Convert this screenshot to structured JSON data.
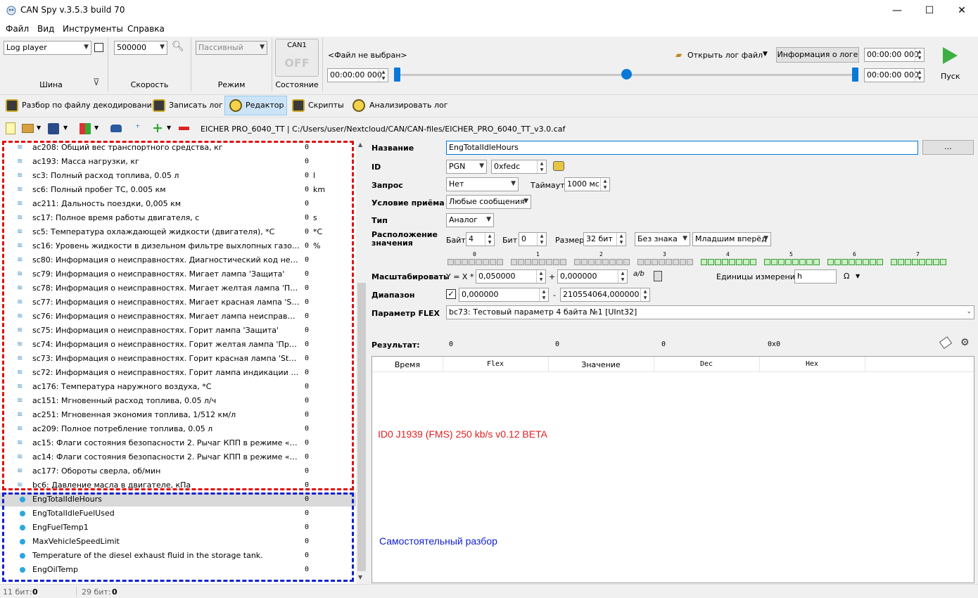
{
  "window": {
    "title": "CAN Spy v.3.5.3 build 70",
    "minimize": "—",
    "maximize": "☐",
    "close": "✕"
  },
  "menu": [
    "Файл",
    "Вид",
    "Инструменты",
    "Справка"
  ],
  "toolbar": {
    "bus": {
      "value": "Log player",
      "label": "Шина"
    },
    "speed": {
      "value": "500000",
      "label": "Скорость"
    },
    "mode": {
      "value": "Пассивный",
      "label": "Режим"
    },
    "state": {
      "channel": "CAN1",
      "value": "OFF",
      "label": "Состояние"
    },
    "file_status": "<Файл не выбран>",
    "open_log": "Открыть лог файл",
    "log_info": "Информация о логе",
    "time_start": "00:00:00 000",
    "time_left": "00:00:00  000",
    "time_end": "00:00:00 000",
    "play": "Пуск"
  },
  "tabs": [
    "Разбор по файлу декодирования",
    "Записать лог",
    "Редактор",
    "Скрипты",
    "Анализировать лог"
  ],
  "active_tab": "Редактор",
  "filepath": "EICHER PRO_6040_TT | C:/Users/user/Nextcloud/CAN/CAN-files/EICHER_PRO_6040_TT_v3.0.caf",
  "params": [
    {
      "name": "ac208: Общий вес транспортного средства, кг",
      "value": "0",
      "unit": ""
    },
    {
      "name": "ac193: Масса нагрузки, кг",
      "value": "0",
      "unit": ""
    },
    {
      "name": "sc3: Полный расход топлива, 0.05 л",
      "value": "0",
      "unit": "l"
    },
    {
      "name": "sc6: Полный пробег ТС, 0.005 км",
      "value": "0",
      "unit": "km"
    },
    {
      "name": "ac211: Дальность поездки, 0,005 км",
      "value": "0",
      "unit": ""
    },
    {
      "name": "sc17: Полное время работы двигателя, с",
      "value": "0",
      "unit": "s"
    },
    {
      "name": "sc5: Температура охлаждающей жидкости (двигателя), *С",
      "value": "0",
      "unit": "*C"
    },
    {
      "name": "sc16: Уровень жидкости в дизельном фильтре выхлопных газов, %",
      "value": "0",
      "unit": "%"
    },
    {
      "name": "sc80: Информация о неисправностях. Диагностический код неисп...",
      "value": "0",
      "unit": ""
    },
    {
      "name": "sc79: Информация о неисправностях. Мигает лампа 'Защита'",
      "value": "0",
      "unit": ""
    },
    {
      "name": "sc78: Информация о неисправностях. Мигает желтая лампа 'Преду...",
      "value": "0",
      "unit": ""
    },
    {
      "name": "sc77: Информация о неисправностях. Мигает красная лампа 'Stop'",
      "value": "0",
      "unit": ""
    },
    {
      "name": "sc76: Информация о неисправностях. Мигает лампа неисправности",
      "value": "0",
      "unit": ""
    },
    {
      "name": "sc75: Информация о неисправностях. Горит лампа 'Защита'",
      "value": "0",
      "unit": ""
    },
    {
      "name": "sc74: Информация о неисправностях. Горит желтая лампа 'Предуп...",
      "value": "0",
      "unit": ""
    },
    {
      "name": "sc73: Информация о неисправностях. Горит красная лампа 'Stop'",
      "value": "0",
      "unit": ""
    },
    {
      "name": "sc72: Информация о неисправностях. Горит лампа индикации неи...",
      "value": "0",
      "unit": ""
    },
    {
      "name": "ac176: Температура наружного воздуха, *С",
      "value": "0",
      "unit": ""
    },
    {
      "name": "ac151: Мгновенный расход топлива, 0.05 л/ч",
      "value": "0",
      "unit": ""
    },
    {
      "name": "ac251: Мгновенная экономия топлива, 1/512 км/л",
      "value": "0",
      "unit": ""
    },
    {
      "name": "ac209: Полное потребление топлива, 0.05 л",
      "value": "0",
      "unit": ""
    },
    {
      "name": "ac15: Флаги состояния безопасности 2. Рычаг КПП в режиме «нейт...",
      "value": "0",
      "unit": ""
    },
    {
      "name": "ac14: Флаги состояния безопасности 2. Рычаг КПП в режиме «задн...",
      "value": "0",
      "unit": ""
    },
    {
      "name": "ac177: Обороты сверла, об/мин",
      "value": "0",
      "unit": ""
    },
    {
      "name": "bc6: Давление масла в двигателе, кПа",
      "value": "0",
      "unit": ""
    }
  ],
  "custom_params": [
    {
      "name": "EngTotalIdleHours",
      "value": "0"
    },
    {
      "name": "EngTotalIdleFuelUsed",
      "value": "0"
    },
    {
      "name": "EngFuelTemp1",
      "value": "0"
    },
    {
      "name": "MaxVehicleSpeedLimit",
      "value": "0"
    },
    {
      "name": "Temperature of the diesel exhaust fluid in the storage tank.",
      "value": "0"
    },
    {
      "name": "EngOilTemp",
      "value": "0"
    }
  ],
  "editor": {
    "name_label": "Название",
    "name_value": "EngTotalIdleHours",
    "name_btn": "...",
    "id_label": "ID",
    "id_type": "PGN",
    "id_value": "0xfedc",
    "request_label": "Запрос",
    "request_value": "Нет",
    "timeout_label": "Таймаут",
    "timeout_value": "1000 мс",
    "recv_label": "Условие приёма",
    "recv_value": "Любые сообщения",
    "type_label": "Тип",
    "type_value": "Аналог",
    "loc_label": "Расположение значения",
    "byte_label": "Байт",
    "byte_value": "4",
    "bit_label": "Бит",
    "bit_value": "0",
    "size_label": "Размер",
    "size_value": "32 бит",
    "sign_value": "Без знака",
    "order_value": "Младшим вперёд",
    "byte_numbers": [
      "0",
      "1",
      "2",
      "3",
      "4",
      "5",
      "6",
      "7"
    ],
    "scale_label": "Масштабировать",
    "scale_formula": "Y = X *",
    "scale_value": "0,050000",
    "plus": "+",
    "offset_value": "0,000000",
    "ab_icon": "a/b",
    "units_label": "Единицы измерения:",
    "units_value": "h",
    "omega": "Ω",
    "range_label": "Диапазон",
    "range_min": "0,000000",
    "range_dash": "-",
    "range_max": "210554064,000000",
    "flex_label": "Параметр FLEX",
    "flex_value": "bc73: Тестовый параметр 4 байта №1 [UInt32]",
    "result_label": "Результат:",
    "result_values": [
      "0",
      "0",
      "0",
      "0x0"
    ],
    "columns": [
      "Время",
      "Flex",
      "Значение",
      "Dec",
      "Hex"
    ],
    "annotation_red": "ID0 J1939 (FMS) 250 kb/s v0.12 BETA",
    "annotation_blue": "Самостоятельный разбор"
  },
  "statusbar": {
    "bits11_label": "11 бит:",
    "bits11_value": "0",
    "bits29_label": "29 бит:",
    "bits29_value": "0"
  }
}
